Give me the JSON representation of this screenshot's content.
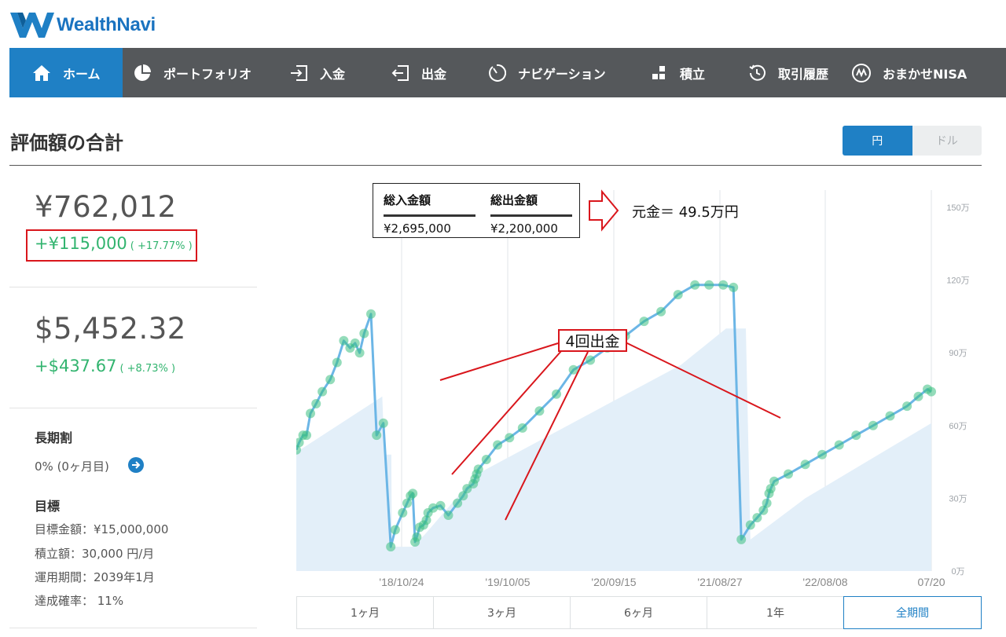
{
  "brand": {
    "name": "WealthNavi"
  },
  "nav": [
    {
      "label": "ホーム",
      "icon": "home-icon",
      "active": true
    },
    {
      "label": "ポートフォリオ",
      "icon": "pie-chart-icon"
    },
    {
      "label": "入金",
      "icon": "deposit-icon"
    },
    {
      "label": "出金",
      "icon": "withdraw-icon"
    },
    {
      "label": "ナビゲーション",
      "icon": "gauge-icon"
    },
    {
      "label": "積立",
      "icon": "blocks-icon"
    },
    {
      "label": "取引履歴",
      "icon": "history-icon"
    },
    {
      "label": "おまかせNISA",
      "icon": "nisa-icon"
    }
  ],
  "page": {
    "title": "評価額の合計",
    "currency_options": [
      "円",
      "ドル"
    ],
    "currency_selected": "円"
  },
  "summary": {
    "jpy": {
      "value": "¥762,012",
      "gain": "+¥115,000",
      "gain_pct": "( +17.77% )"
    },
    "usd": {
      "value": "$5,452.32",
      "gain": "+$437.67",
      "gain_pct": "( +8.73% )"
    }
  },
  "long_term": {
    "heading": "長期割",
    "value": "0% (0ヶ月目)"
  },
  "goal": {
    "heading": "目標",
    "target": "目標金額：¥15,000,000",
    "monthly": "積立額：30,000 円/月",
    "period": "運用期間：2039年1月",
    "probability": "達成確率： 11%"
  },
  "annotation": {
    "col1_label": "総入金額",
    "col1_value": "¥2,695,000",
    "col2_label": "総出金額",
    "col2_value": "¥2,200,000",
    "principal_text": "元金＝ 49.5万円",
    "withdraw_label": "4回出金"
  },
  "periods": [
    "1ヶ月",
    "3ヶ月",
    "6ヶ月",
    "1年",
    "全期間"
  ],
  "period_selected": "全期間",
  "colors": {
    "brand": "#1f80c5",
    "nav": "#55585b",
    "gain": "#32b46f",
    "highlight": "#d9161c",
    "area": "#e3eff9",
    "line": "#6cb6e6"
  },
  "chart_data": {
    "type": "line",
    "x_ticks": [
      "'18/10/24",
      "'19/10/05",
      "'20/09/15",
      "'21/08/27",
      "'22/08/08",
      "07/20"
    ],
    "y_ticks": [
      "150万",
      "120万",
      "90万",
      "60万",
      "30万",
      "0万"
    ],
    "ylim": [
      0,
      150
    ],
    "unit": "万円",
    "series": [
      {
        "x": [
          0,
          0.5,
          1.2,
          1.8,
          2.5,
          3.5,
          4.6,
          6,
          7.2,
          8.4,
          9.5,
          10.4,
          11.2,
          12,
          13.2,
          14.2,
          15.4,
          16.7,
          17.5,
          18.8,
          19.6,
          20.2,
          20.6,
          21,
          21.3,
          21.8,
          22.5,
          23,
          23.3,
          24.2,
          25.5,
          26.9,
          28.5,
          29.5,
          30.2,
          31.3,
          31.6,
          31.9,
          32.2,
          33.6,
          35.6,
          37.7,
          40,
          43,
          46,
          49,
          52,
          55,
          58.2,
          61.5,
          64.5,
          67.5,
          70.5,
          73,
          75.5,
          77.3,
          78.7,
          80.3,
          81.5,
          82.6,
          83.2,
          83.6,
          83.9,
          84.5,
          87,
          90,
          93,
          96,
          99,
          102,
          105,
          108,
          110,
          111.6,
          112.3
        ],
        "values": [
          50,
          53,
          56,
          56,
          65,
          69,
          74,
          79,
          86,
          95,
          92,
          94,
          90,
          98,
          106,
          56,
          61,
          10,
          17,
          24,
          28,
          31,
          32,
          12,
          14,
          18,
          19,
          21,
          24,
          26,
          27,
          23,
          28,
          31,
          34,
          36,
          38,
          40,
          42,
          46,
          52,
          55,
          59,
          66,
          73,
          83,
          87,
          92,
          97,
          103,
          107,
          114,
          118,
          118,
          118,
          117,
          13,
          19,
          22,
          25,
          28,
          32,
          34,
          37,
          40,
          44,
          48,
          52,
          56,
          60,
          64,
          68,
          72,
          75,
          74
        ]
      },
      {
        "x": [
          0,
          15.2,
          15.6,
          16.8,
          16.9,
          20.5,
          22.7,
          32,
          44,
          56,
          68,
          76,
          79.5,
          80.3,
          90,
          112.3
        ],
        "values": [
          49,
          72,
          48,
          48,
          10,
          10,
          15,
          40,
          55,
          70,
          85,
          100,
          100,
          13,
          30,
          61
        ]
      }
    ]
  }
}
